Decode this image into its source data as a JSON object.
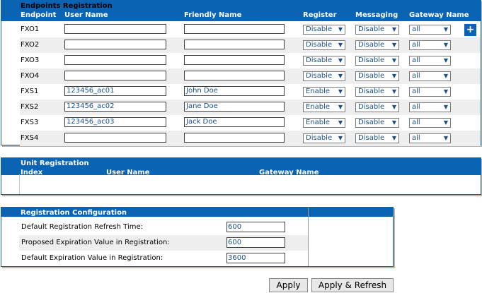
{
  "endpoints": {
    "title": "Endpoints Registration",
    "columns": {
      "endpoint": "Endpoint",
      "user_name": "User Name",
      "friendly_name": "Friendly Name",
      "register": "Register",
      "messaging": "Messaging",
      "gateway_name": "Gateway Name"
    },
    "rows": [
      {
        "name": "FXO1",
        "user": "",
        "friendly": "",
        "register": "Disable",
        "messaging": "Disable",
        "gateway": "all"
      },
      {
        "name": "FXO2",
        "user": "",
        "friendly": "",
        "register": "Disable",
        "messaging": "Disable",
        "gateway": "all"
      },
      {
        "name": "FXO3",
        "user": "",
        "friendly": "",
        "register": "Disable",
        "messaging": "Disable",
        "gateway": "all"
      },
      {
        "name": "FXO4",
        "user": "",
        "friendly": "",
        "register": "Disable",
        "messaging": "Disable",
        "gateway": "all"
      },
      {
        "name": "FXS1",
        "user": "123456_ac01",
        "friendly": "John Doe",
        "register": "Enable",
        "messaging": "Disable",
        "gateway": "all"
      },
      {
        "name": "FXS2",
        "user": "123456_ac02",
        "friendly": "Jane Doe",
        "register": "Enable",
        "messaging": "Disable",
        "gateway": "all"
      },
      {
        "name": "FXS3",
        "user": "123456_ac03",
        "friendly": "Jack Doe",
        "register": "Enable",
        "messaging": "Disable",
        "gateway": "all"
      },
      {
        "name": "FXS4",
        "user": "",
        "friendly": "",
        "register": "Disable",
        "messaging": "Disable",
        "gateway": "all"
      }
    ]
  },
  "unit": {
    "title": "Unit Registration",
    "columns": {
      "index": "Index",
      "user_name": "User Name",
      "gateway_name": "Gateway Name"
    },
    "add_label": "+"
  },
  "config": {
    "title": "Registration Configuration",
    "rows": [
      {
        "label": "Default Registration Refresh Time:",
        "value": "600"
      },
      {
        "label": "Proposed Expiration Value in Registration:",
        "value": "600"
      },
      {
        "label": "Default Expiration Value in Registration:",
        "value": "3600"
      }
    ]
  },
  "buttons": {
    "apply": "Apply",
    "apply_refresh": "Apply & Refresh"
  },
  "icons": {
    "dropdown": "chevron-down-icon",
    "add": "plus-icon"
  },
  "colors": {
    "header_blue": "#0a63b3",
    "value_text": "#1a4e8c",
    "alt_row": "#eeeeee"
  }
}
